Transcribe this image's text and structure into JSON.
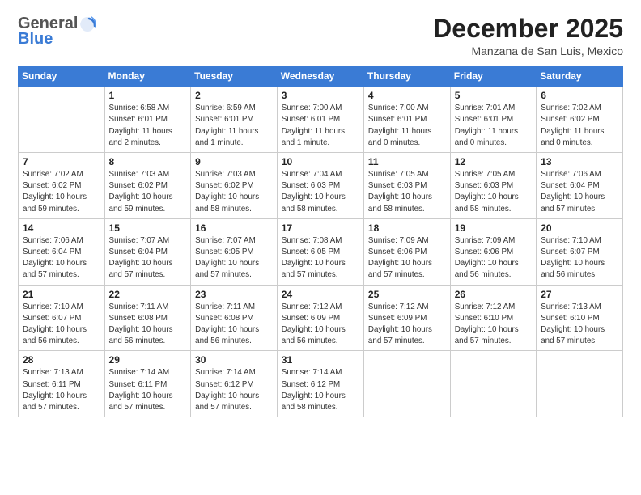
{
  "header": {
    "logo_general": "General",
    "logo_blue": "Blue",
    "month_title": "December 2025",
    "location": "Manzana de San Luis, Mexico"
  },
  "days_of_week": [
    "Sunday",
    "Monday",
    "Tuesday",
    "Wednesday",
    "Thursday",
    "Friday",
    "Saturday"
  ],
  "weeks": [
    [
      {
        "day": "",
        "info": ""
      },
      {
        "day": "1",
        "info": "Sunrise: 6:58 AM\nSunset: 6:01 PM\nDaylight: 11 hours\nand 2 minutes."
      },
      {
        "day": "2",
        "info": "Sunrise: 6:59 AM\nSunset: 6:01 PM\nDaylight: 11 hours\nand 1 minute."
      },
      {
        "day": "3",
        "info": "Sunrise: 7:00 AM\nSunset: 6:01 PM\nDaylight: 11 hours\nand 1 minute."
      },
      {
        "day": "4",
        "info": "Sunrise: 7:00 AM\nSunset: 6:01 PM\nDaylight: 11 hours\nand 0 minutes."
      },
      {
        "day": "5",
        "info": "Sunrise: 7:01 AM\nSunset: 6:01 PM\nDaylight: 11 hours\nand 0 minutes."
      },
      {
        "day": "6",
        "info": "Sunrise: 7:02 AM\nSunset: 6:02 PM\nDaylight: 11 hours\nand 0 minutes."
      }
    ],
    [
      {
        "day": "7",
        "info": "Sunrise: 7:02 AM\nSunset: 6:02 PM\nDaylight: 10 hours\nand 59 minutes."
      },
      {
        "day": "8",
        "info": "Sunrise: 7:03 AM\nSunset: 6:02 PM\nDaylight: 10 hours\nand 59 minutes."
      },
      {
        "day": "9",
        "info": "Sunrise: 7:03 AM\nSunset: 6:02 PM\nDaylight: 10 hours\nand 58 minutes."
      },
      {
        "day": "10",
        "info": "Sunrise: 7:04 AM\nSunset: 6:03 PM\nDaylight: 10 hours\nand 58 minutes."
      },
      {
        "day": "11",
        "info": "Sunrise: 7:05 AM\nSunset: 6:03 PM\nDaylight: 10 hours\nand 58 minutes."
      },
      {
        "day": "12",
        "info": "Sunrise: 7:05 AM\nSunset: 6:03 PM\nDaylight: 10 hours\nand 58 minutes."
      },
      {
        "day": "13",
        "info": "Sunrise: 7:06 AM\nSunset: 6:04 PM\nDaylight: 10 hours\nand 57 minutes."
      }
    ],
    [
      {
        "day": "14",
        "info": "Sunrise: 7:06 AM\nSunset: 6:04 PM\nDaylight: 10 hours\nand 57 minutes."
      },
      {
        "day": "15",
        "info": "Sunrise: 7:07 AM\nSunset: 6:04 PM\nDaylight: 10 hours\nand 57 minutes."
      },
      {
        "day": "16",
        "info": "Sunrise: 7:07 AM\nSunset: 6:05 PM\nDaylight: 10 hours\nand 57 minutes."
      },
      {
        "day": "17",
        "info": "Sunrise: 7:08 AM\nSunset: 6:05 PM\nDaylight: 10 hours\nand 57 minutes."
      },
      {
        "day": "18",
        "info": "Sunrise: 7:09 AM\nSunset: 6:06 PM\nDaylight: 10 hours\nand 57 minutes."
      },
      {
        "day": "19",
        "info": "Sunrise: 7:09 AM\nSunset: 6:06 PM\nDaylight: 10 hours\nand 56 minutes."
      },
      {
        "day": "20",
        "info": "Sunrise: 7:10 AM\nSunset: 6:07 PM\nDaylight: 10 hours\nand 56 minutes."
      }
    ],
    [
      {
        "day": "21",
        "info": "Sunrise: 7:10 AM\nSunset: 6:07 PM\nDaylight: 10 hours\nand 56 minutes."
      },
      {
        "day": "22",
        "info": "Sunrise: 7:11 AM\nSunset: 6:08 PM\nDaylight: 10 hours\nand 56 minutes."
      },
      {
        "day": "23",
        "info": "Sunrise: 7:11 AM\nSunset: 6:08 PM\nDaylight: 10 hours\nand 56 minutes."
      },
      {
        "day": "24",
        "info": "Sunrise: 7:12 AM\nSunset: 6:09 PM\nDaylight: 10 hours\nand 56 minutes."
      },
      {
        "day": "25",
        "info": "Sunrise: 7:12 AM\nSunset: 6:09 PM\nDaylight: 10 hours\nand 57 minutes."
      },
      {
        "day": "26",
        "info": "Sunrise: 7:12 AM\nSunset: 6:10 PM\nDaylight: 10 hours\nand 57 minutes."
      },
      {
        "day": "27",
        "info": "Sunrise: 7:13 AM\nSunset: 6:10 PM\nDaylight: 10 hours\nand 57 minutes."
      }
    ],
    [
      {
        "day": "28",
        "info": "Sunrise: 7:13 AM\nSunset: 6:11 PM\nDaylight: 10 hours\nand 57 minutes."
      },
      {
        "day": "29",
        "info": "Sunrise: 7:14 AM\nSunset: 6:11 PM\nDaylight: 10 hours\nand 57 minutes."
      },
      {
        "day": "30",
        "info": "Sunrise: 7:14 AM\nSunset: 6:12 PM\nDaylight: 10 hours\nand 57 minutes."
      },
      {
        "day": "31",
        "info": "Sunrise: 7:14 AM\nSunset: 6:12 PM\nDaylight: 10 hours\nand 58 minutes."
      },
      {
        "day": "",
        "info": ""
      },
      {
        "day": "",
        "info": ""
      },
      {
        "day": "",
        "info": ""
      }
    ]
  ]
}
